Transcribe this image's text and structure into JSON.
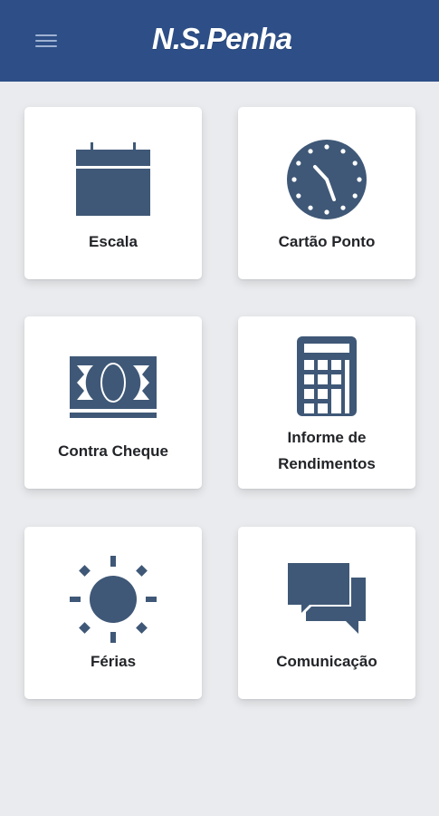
{
  "header": {
    "logo_text": "N.S.Penha",
    "menu_icon": "hamburger-menu-icon",
    "background": "#2d4e86"
  },
  "colors": {
    "icon": "#3f5877",
    "card": "#ffffff",
    "background": "#e9ebee"
  },
  "menu": [
    {
      "label": "Escala",
      "icon": "calendar-icon"
    },
    {
      "label": "Cartão Ponto",
      "icon": "clock-icon"
    },
    {
      "label": "Contra Cheque",
      "icon": "money-bill-icon"
    },
    {
      "label_line1": "Informe de",
      "label_line2": "Rendimentos",
      "icon": "calculator-icon"
    },
    {
      "label": "Férias",
      "icon": "sun-icon"
    },
    {
      "label": "Comunicação",
      "icon": "chat-bubbles-icon"
    }
  ]
}
